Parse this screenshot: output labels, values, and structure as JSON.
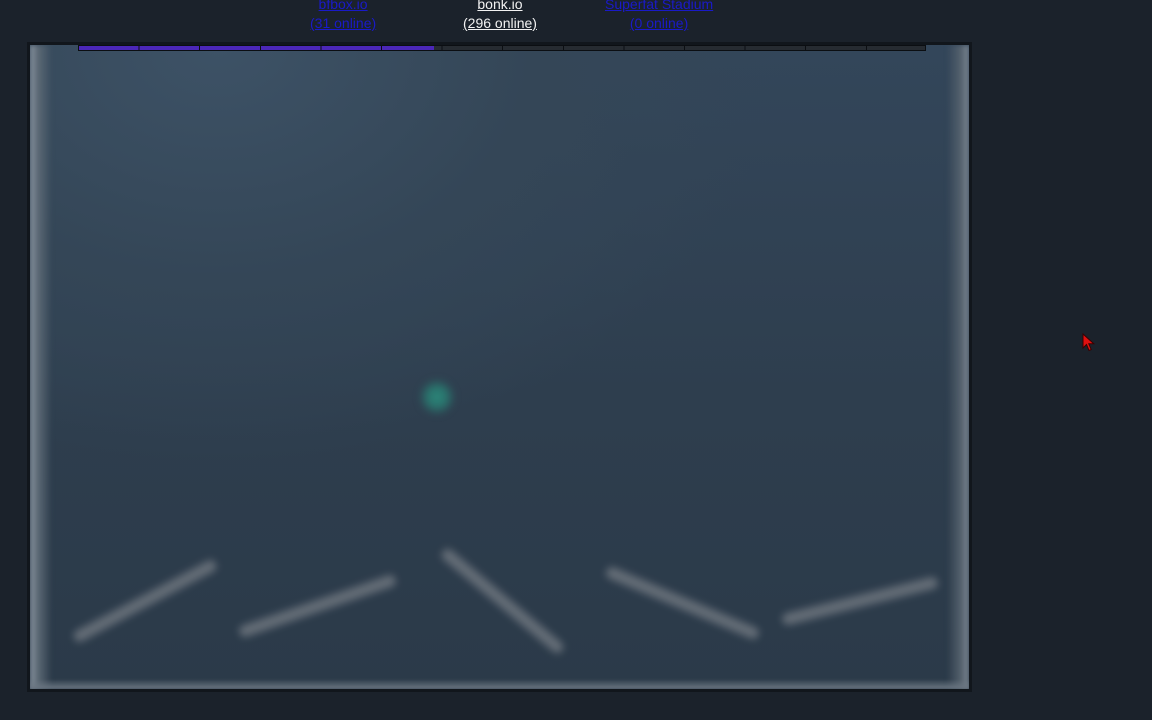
{
  "header": {
    "links": [
      {
        "name": "bfbox.io",
        "online": "(31 online)",
        "current": false
      },
      {
        "name": "bonk.io",
        "online": "(296 online)",
        "current": true
      },
      {
        "name": "Superfat Stadium",
        "online": "(0 online)",
        "current": false
      }
    ]
  },
  "game": {
    "progress_fraction": 0.42,
    "progress_segments": 14,
    "colors": {
      "progress_fill": "#4b27b8",
      "player": "#2c8a7c",
      "background": "#2e3e4e",
      "platform": "#6a727b"
    }
  },
  "icons": {
    "cursor": "pointer-arrow-icon"
  }
}
